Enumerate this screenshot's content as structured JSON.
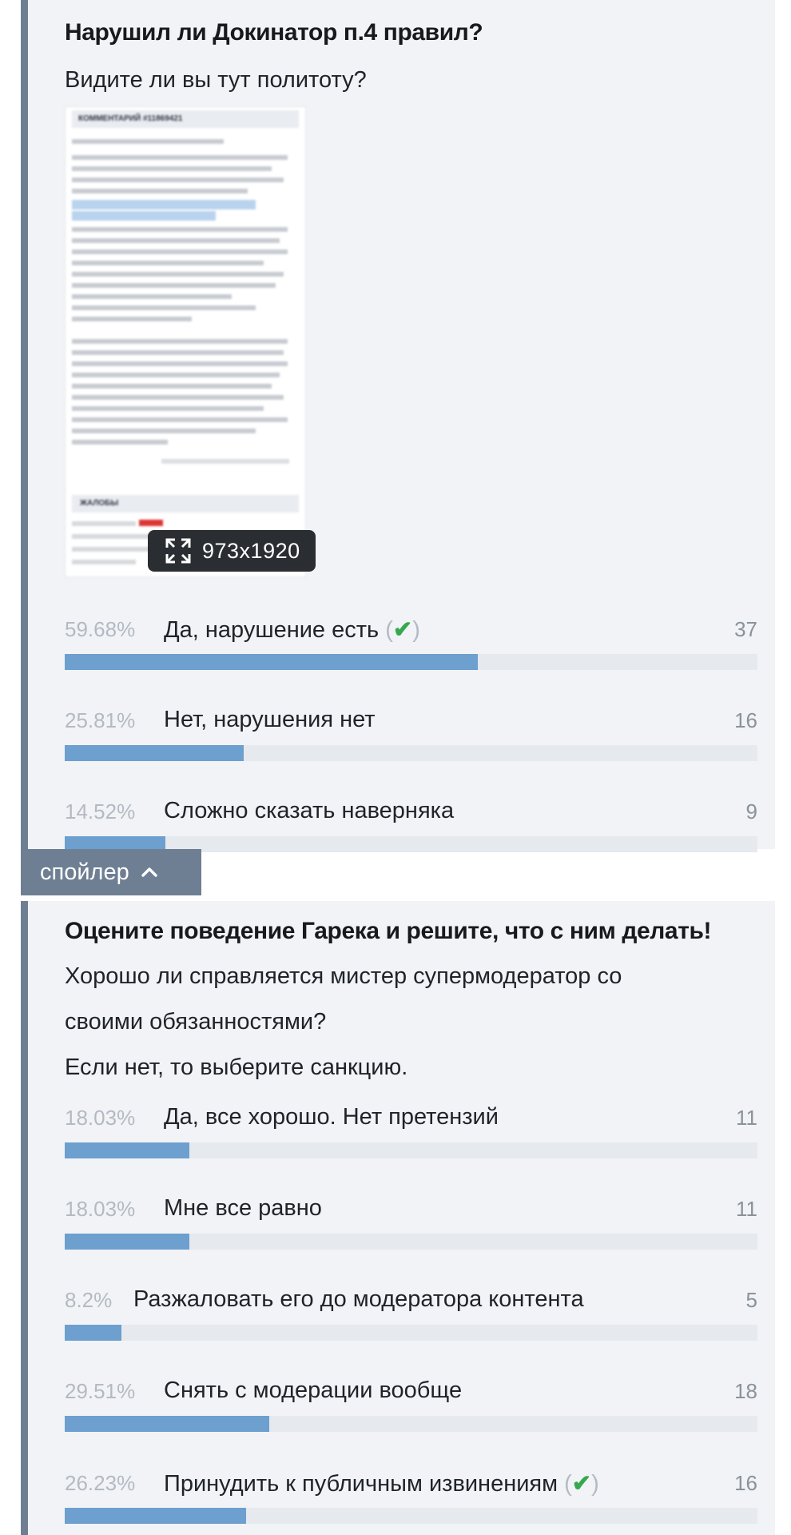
{
  "poll1": {
    "title": "Нарушил ли Докинатор п.4 правил?",
    "description": "Видите ли вы тут политоту?",
    "image": {
      "header": "КОММЕНТАРИЙ #11869421",
      "section": "ЖАЛОБЫ",
      "dimensions_label": "973x1920"
    },
    "options": [
      {
        "percent": "59.68%",
        "label": "Да, нарушение есть",
        "count": "37",
        "fraction": 0.5968,
        "checked": true
      },
      {
        "percent": "25.81%",
        "label": "Нет, нарушения нет",
        "count": "16",
        "fraction": 0.2581,
        "checked": false
      },
      {
        "percent": "14.52%",
        "label": "Сложно сказать наверняка",
        "count": "9",
        "fraction": 0.1452,
        "checked": false
      }
    ]
  },
  "spoiler": {
    "label": "спойлер",
    "icon": "chevron-up-icon"
  },
  "poll2": {
    "title": "Оцените поведение Гарека и решите, что с ним делать!",
    "description_lines": [
      "Хорошо ли справляется мистер супермодератор со",
      "своими обязанностями?",
      "Если нет, то выберите санкцию."
    ],
    "options": [
      {
        "percent": "18.03%",
        "label": "Да, все хорошо. Нет претензий",
        "count": "11",
        "fraction": 0.1803,
        "checked": false
      },
      {
        "percent": "18.03%",
        "label": "Мне все равно",
        "count": "11",
        "fraction": 0.1803,
        "checked": false
      },
      {
        "percent": "8.2%",
        "label": "Разжаловать его до модератора контента",
        "count": "5",
        "fraction": 0.082,
        "checked": false
      },
      {
        "percent": "29.51%",
        "label": "Снять с модерации вообще",
        "count": "18",
        "fraction": 0.2951,
        "checked": false
      },
      {
        "percent": "26.23%",
        "label": "Принудить к публичным извинениям",
        "count": "16",
        "fraction": 0.2623,
        "checked": true
      }
    ]
  },
  "check_glyph": "✔",
  "colors": {
    "accent_bar": "#6d9fcf",
    "panel_bg": "#f1f3f6",
    "left_border": "#6f7f93",
    "check": "#36a84e"
  }
}
